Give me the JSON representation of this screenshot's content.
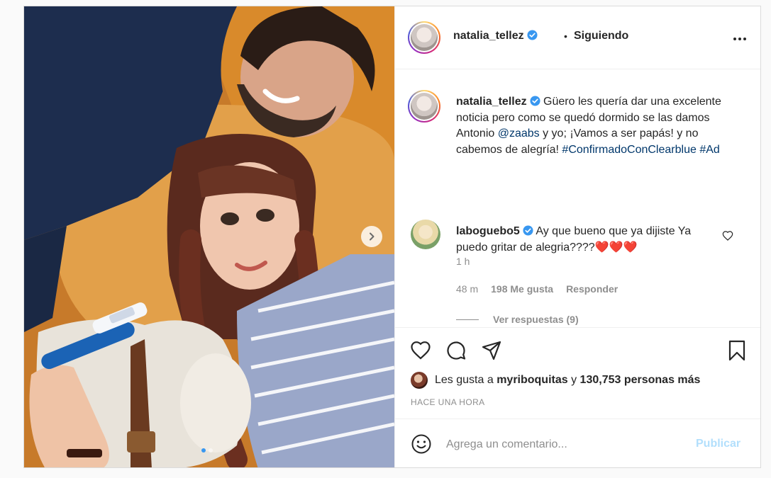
{
  "header": {
    "username": "natalia_tellez",
    "separator": "•",
    "follow_status": "Siguiendo"
  },
  "caption": {
    "username": "natalia_tellez",
    "text_part1": " Güero les quería dar una excelente noticia pero como se quedó dormido se las damos Antonio ",
    "mention": "@zaabs",
    "text_part2": " y yo; ¡Vamos a ser papás! y no cabemos de alegría! ",
    "hashtag1": "#ConfirmadoConClearblue",
    "hashtag2": "#Ad",
    "time": "1 h"
  },
  "comment": {
    "username": "laboguebo5",
    "text": " Ay que bueno que ya dijiste Ya puedo gritar de alegria????",
    "emoji": "❤️❤️❤️",
    "time": "48 m",
    "likes": "198 Me gusta",
    "reply": "Responder",
    "view_replies": "Ver respuestas (9)"
  },
  "likes": {
    "prefix": "Les gusta a ",
    "user": "myriboquitas",
    "middle": " y ",
    "count": "130,753 personas más"
  },
  "posted": "HACE UNA HORA",
  "add_comment": {
    "placeholder": "Agrega un comentario...",
    "publish": "Publicar"
  },
  "colors": {
    "link": "#00376b",
    "verified": "#3897f0",
    "muted": "#8e8e8e",
    "publish_disabled": "#b2dffc",
    "border": "#dbdbdb"
  },
  "icons": [
    "verified-badge-icon",
    "more-options-icon",
    "heart-icon",
    "comment-icon",
    "share-icon",
    "bookmark-icon",
    "smile-icon",
    "chevron-right-icon"
  ],
  "carousel": {
    "slides": 2,
    "active": 1
  }
}
